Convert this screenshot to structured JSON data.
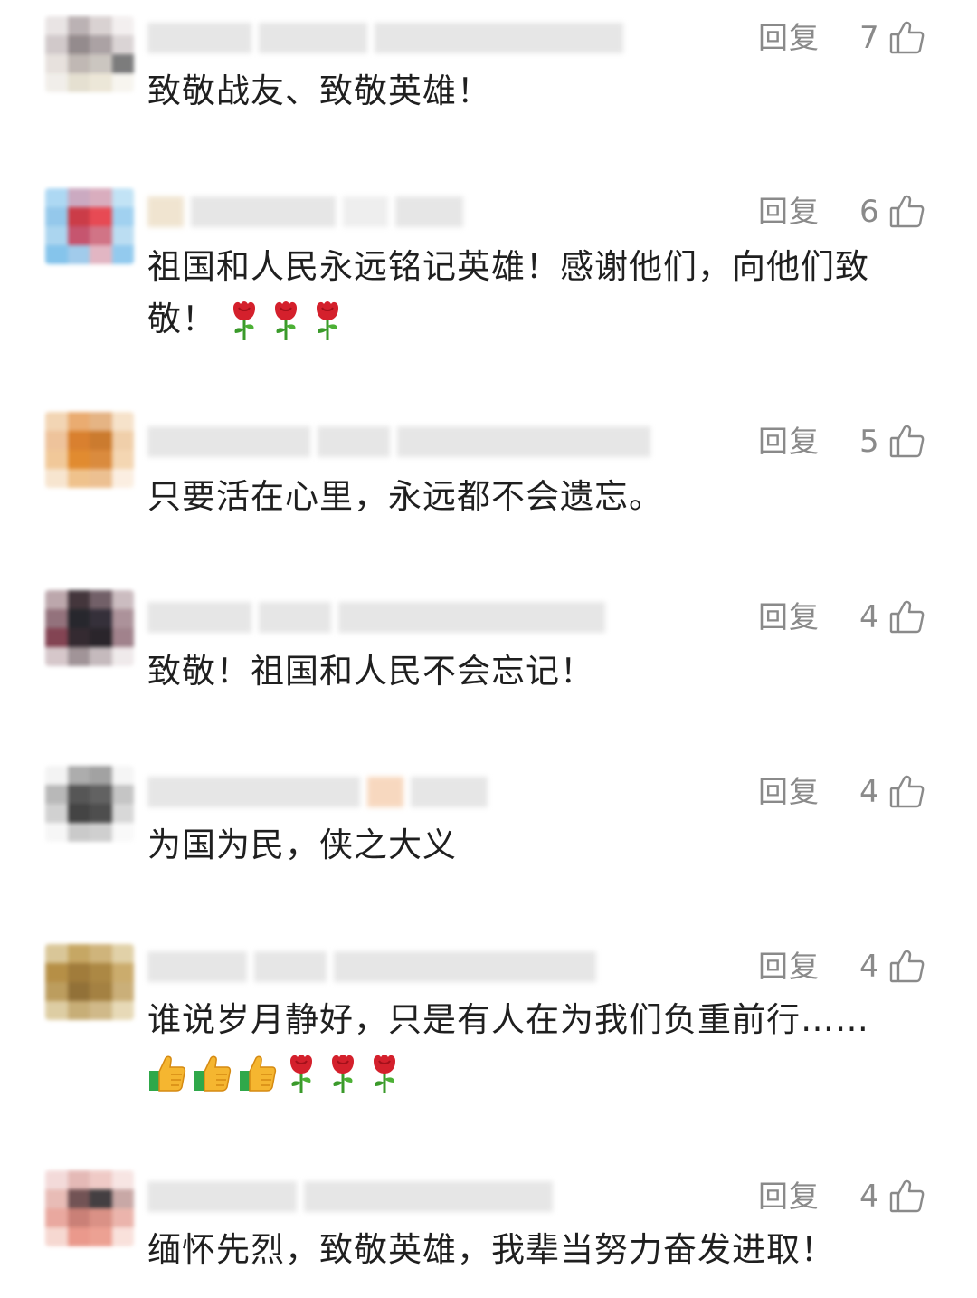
{
  "reply_label": "回复",
  "comments": [
    {
      "likes": "7",
      "text": "致敬战友、致敬英雄！",
      "text_line2": ""
    },
    {
      "likes": "6",
      "text": "祖国和人民永远铭记英雄！感谢他们，向他们致",
      "text_line2": "敬！"
    },
    {
      "likes": "5",
      "text": "只要活在心里，永远都不会遗忘。",
      "text_line2": ""
    },
    {
      "likes": "4",
      "text": "致敬！祖国和人民不会忘记！",
      "text_line2": ""
    },
    {
      "likes": "4",
      "text": "为国为民，侠之大义",
      "text_line2": ""
    },
    {
      "likes": "4",
      "text": "谁说岁月静好，只是有人在为我们负重前行……",
      "text_line2": ""
    },
    {
      "likes": "4",
      "text": "缅怀先烈，致敬英雄，我辈当努力奋发进取！",
      "text_line2": ""
    }
  ],
  "icons": {
    "like": "thumbs-up-outline-icon",
    "rose": "rose-emoji-icon",
    "thumbs_emoji": "thumbs-up-emoji-icon"
  },
  "colors": {
    "meta_text": "#8a8a8a",
    "comment_text": "#1f1f1f",
    "rose_red": "#d4202c",
    "stem_green": "#3a9a2a"
  }
}
